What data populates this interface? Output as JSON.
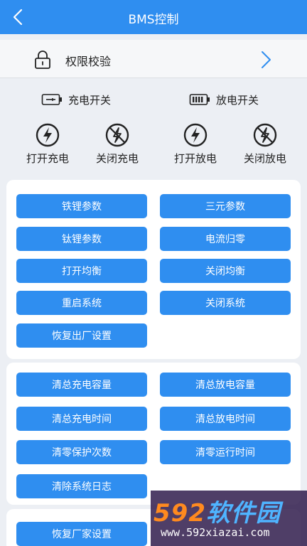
{
  "header": {
    "title": "BMS控制"
  },
  "auth": {
    "label": "权限校验"
  },
  "switches": {
    "charge_title": "充电开关",
    "discharge_title": "放电开关",
    "ops": [
      {
        "label": "打开充电"
      },
      {
        "label": "关闭充电"
      },
      {
        "label": "打开放电"
      },
      {
        "label": "关闭放电"
      }
    ]
  },
  "group1": {
    "buttons": [
      "铁锂参数",
      "三元参数",
      "钛锂参数",
      "电流归零",
      "打开均衡",
      "关闭均衡",
      "重启系统",
      "关闭系统",
      "恢复出厂设置"
    ]
  },
  "group2": {
    "buttons": [
      "清总充电容量",
      "清总放电容量",
      "清总充电时间",
      "清总放电时间",
      "清零保护次数",
      "清零运行时间",
      "清除系统日志"
    ]
  },
  "group3": {
    "buttons": [
      "恢复厂家设置"
    ]
  },
  "watermark": {
    "brand_num": "592",
    "brand_cn": "软件园",
    "url": "www.592xiazai.com"
  },
  "colors": {
    "accent": "#2f8ef0",
    "background": "#eceff4"
  }
}
